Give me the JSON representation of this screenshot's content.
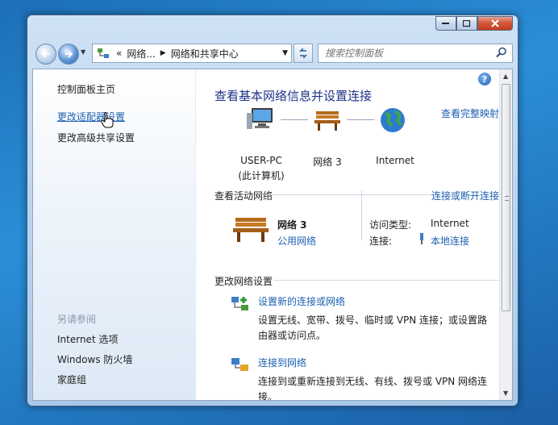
{
  "window": {
    "caption_buttons": [
      "minimize",
      "maximize",
      "close"
    ]
  },
  "toolbar": {
    "breadcrumb": [
      "«",
      "网络...",
      "网络和共享中心"
    ],
    "search_placeholder": "搜索控制面板"
  },
  "sidebar": {
    "items": [
      {
        "label": "控制面板主页"
      },
      {
        "label": "更改适配器设置"
      },
      {
        "label": "更改高级共享设置"
      }
    ],
    "see_also_header": "另请参阅",
    "see_also": [
      {
        "label": "Internet 选项"
      },
      {
        "label": "Windows 防火墙"
      },
      {
        "label": "家庭组"
      }
    ]
  },
  "main": {
    "title": "查看基本网络信息并设置连接",
    "full_map_link": "查看完整映射",
    "map_nodes": [
      {
        "label": "USER-PC",
        "sublabel": "(此计算机)"
      },
      {
        "label": "网络  3"
      },
      {
        "label": "Internet"
      }
    ],
    "active_networks": {
      "header": "查看活动网络",
      "action": "连接或断开连接",
      "network_name": "网络  3",
      "network_type": "公用网络",
      "access_type_label": "访问类型:",
      "access_type_value": "Internet",
      "connection_label": "连接:",
      "connection_value": "本地连接"
    },
    "change_settings": {
      "header": "更改网络设置",
      "tasks": [
        {
          "link": "设置新的连接或网络",
          "desc": "设置无线、宽带、拨号、临时或 VPN 连接；或设置路由器或访问点。"
        },
        {
          "link": "连接到网络",
          "desc": "连接到或重新连接到无线、有线、拨号或 VPN 网络连接。"
        }
      ]
    }
  },
  "colors": {
    "link": "#1c5fb1",
    "title": "#1e3287",
    "desktop": "#2a8fd8",
    "close_button": "#c43b1c"
  }
}
